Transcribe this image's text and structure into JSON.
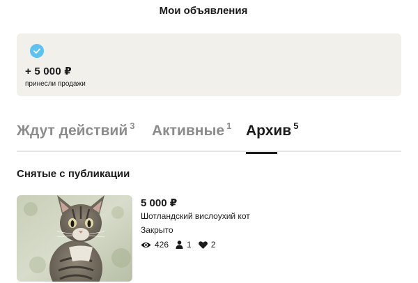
{
  "header": {
    "title": "Мои объявления"
  },
  "sales_card": {
    "amount": "+ 5  000 ₽",
    "caption": "принесли продажи",
    "icon": "check-circle-icon",
    "accent_color": "#5bc2f2",
    "background": "#f2f0eb"
  },
  "tabs": [
    {
      "label": "Ждут действий",
      "count": "3",
      "active": false
    },
    {
      "label": "Активные",
      "count": "1",
      "active": false
    },
    {
      "label": "Архив",
      "count": "5",
      "active": true
    }
  ],
  "section": {
    "title": "Снятые с публикации"
  },
  "listing": {
    "photo": "cat-photo",
    "price": "5 000 ₽",
    "title": "Шотландский вислоухий кот",
    "status": "Закрыто",
    "stats": {
      "views": "426",
      "contacts": "1",
      "favorites": "2"
    }
  }
}
